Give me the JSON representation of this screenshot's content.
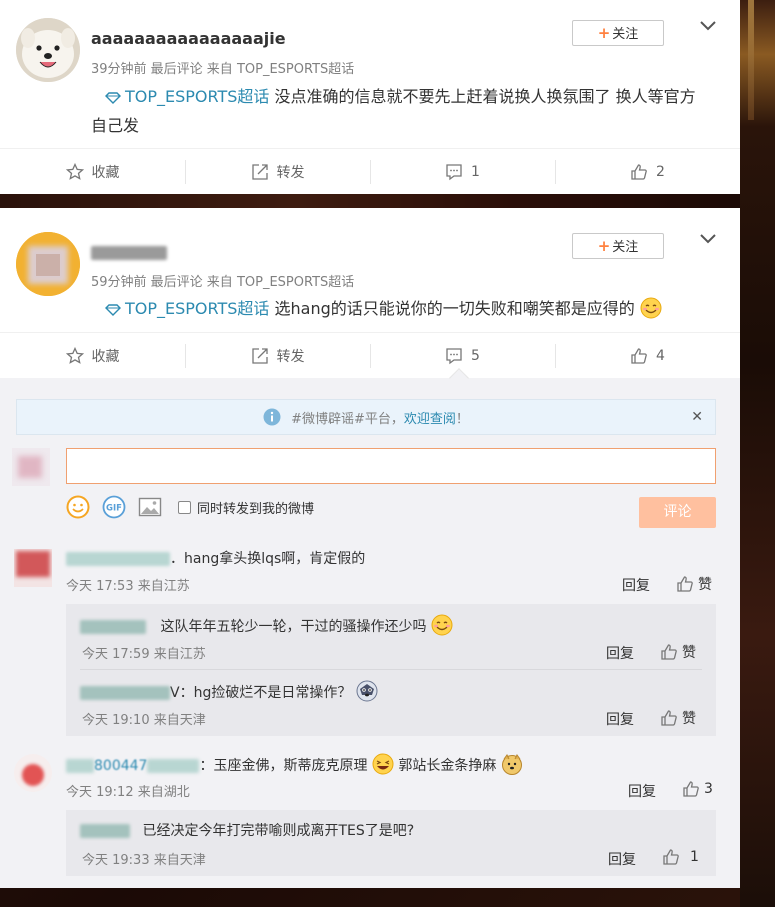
{
  "posts": [
    {
      "username": "aaaaaaaaaaaaaaaajie",
      "meta": "39分钟前 最后评论 来自 TOP_ESPORTS超话",
      "topic": "TOP_ESPORTS超话",
      "text": " 没点准确的信息就不要先上赶着说换人换氛围了 换人等官方自己发",
      "follow_label": "关注",
      "actions": {
        "favorite": "收藏",
        "repost": "转发",
        "comment_count": "1",
        "like_count": "2"
      }
    },
    {
      "username": "",
      "meta": "59分钟前 最后评论 来自 TOP_ESPORTS超话",
      "topic": "TOP_ESPORTS超话",
      "text": " 选hang的话只能说你的一切失败和嘲笑都是应得的",
      "follow_label": "关注",
      "actions": {
        "favorite": "收藏",
        "repost": "转发",
        "comment_count": "5",
        "like_count": "4"
      }
    }
  ],
  "notice": {
    "prefix": "#微博辟谣#平台，",
    "link": "欢迎查阅",
    "suffix": "！"
  },
  "composer": {
    "repost_checkbox_label": "同时转发到我的微博",
    "submit_label": "评论"
  },
  "comments": [
    {
      "name_visible": "",
      "text": "．hang拿头换lqs啊，肯定假的",
      "time": "今天 17:53 来自江苏",
      "reply": "回复",
      "like": "赞",
      "replies": [
        {
          "name_visible": "",
          "text": "这队年年五轮少一轮，干过的骚操作还少吗",
          "time": "今天 17:59 来自江苏",
          "reply": "回复",
          "like": "赞"
        },
        {
          "name_visible": "",
          "text": "V：hg捡破烂不是日常操作？",
          "time": "今天 19:10 来自天津",
          "reply": "回复",
          "like": "赞"
        }
      ]
    },
    {
      "name_visible": "800447",
      "text": "：玉座金佛，斯蒂庞克原理",
      "text2": "郭站长金条挣麻",
      "time": "今天 19:12 来自湖北",
      "reply": "回复",
      "like": "3",
      "replies": [
        {
          "name_visible": "",
          "text": "已经决定今年打完带喻则成离开TES了是吧?",
          "time": "今天 19:33 来自天津",
          "reply": "回复",
          "like": "1"
        }
      ]
    }
  ],
  "icons": {
    "topic": "diamond-topic-icon",
    "favorite": "star-icon",
    "repost": "share-icon",
    "comment": "comment-icon",
    "like": "thumbs-up-icon",
    "info": "info-icon",
    "emoji": "emoji-icon",
    "gif": "gif-icon",
    "image": "image-icon",
    "chevron": "chevron-down-icon"
  },
  "colors": {
    "link": "#2c8ab0",
    "accent": "#ff8140",
    "submit_bg": "#ffc09f",
    "input_border": "#f0a070"
  }
}
